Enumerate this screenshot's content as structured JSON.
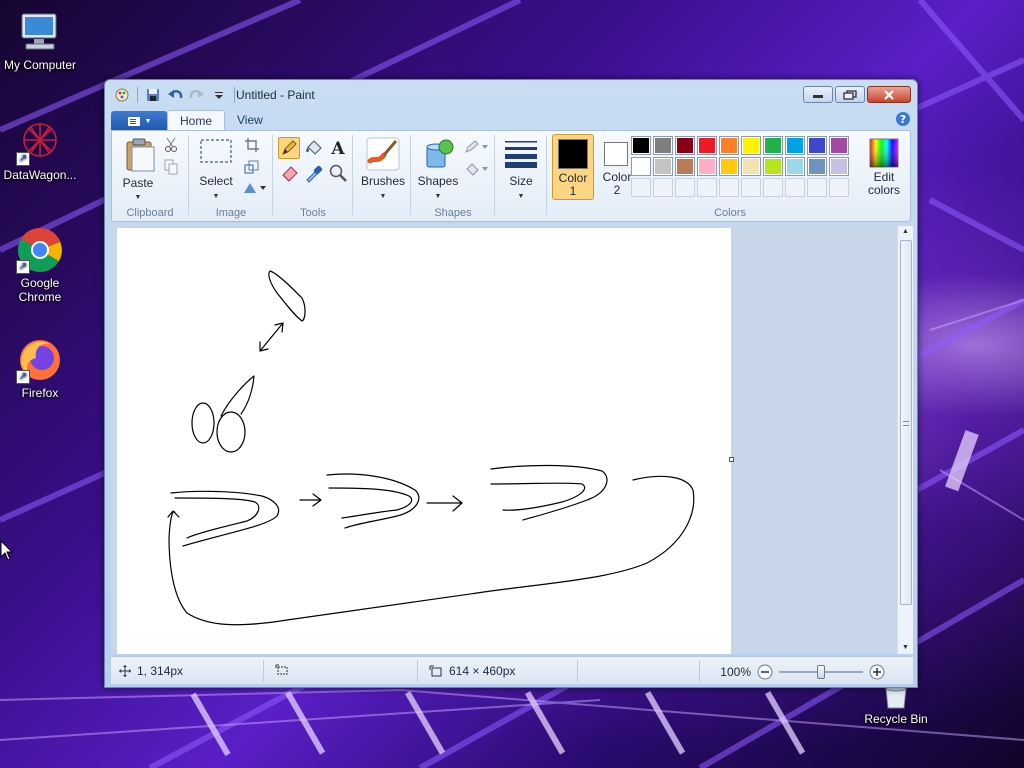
{
  "desktop": {
    "icons": [
      {
        "label": "My Computer"
      },
      {
        "label": "DataWagon..."
      },
      {
        "label": "Google Chrome"
      },
      {
        "label": "Firefox"
      },
      {
        "label": "Recycle Bin"
      }
    ]
  },
  "window": {
    "title": "Untitled - Paint",
    "tabs": [
      "Home",
      "View"
    ],
    "ribbon": {
      "clipboard": {
        "group_label": "Clipboard",
        "paste": "Paste"
      },
      "image": {
        "group_label": "Image",
        "select": "Select"
      },
      "tools": {
        "group_label": "Tools"
      },
      "brushes": {
        "label": "Brushes"
      },
      "shapes": {
        "group_label": "Shapes",
        "label": "Shapes"
      },
      "size": {
        "label": "Size"
      },
      "colors": {
        "group_label": "Colors",
        "color1_line1": "Color",
        "color1_line2": "1",
        "color2_line1": "Color",
        "color2_line2": "2",
        "edit_line1": "Edit",
        "edit_line2": "colors",
        "color1_value": "#000000",
        "color2_value": "#ffffff",
        "palette_row1": [
          "#000000",
          "#7f7f7f",
          "#880015",
          "#ed1c24",
          "#ff7f27",
          "#fff200",
          "#22b14c",
          "#00a2e8",
          "#3f48cc",
          "#a349a4"
        ],
        "palette_row2": [
          "#ffffff",
          "#c3c3c3",
          "#b97a57",
          "#ffaec9",
          "#ffc90e",
          "#efe4b0",
          "#b5e61d",
          "#99d9ea",
          "#7092be",
          "#c8bfe7"
        ]
      }
    },
    "status": {
      "cursor_pos": "1, 314px",
      "canvas_size": "614 × 460px",
      "zoom": "100%"
    }
  }
}
